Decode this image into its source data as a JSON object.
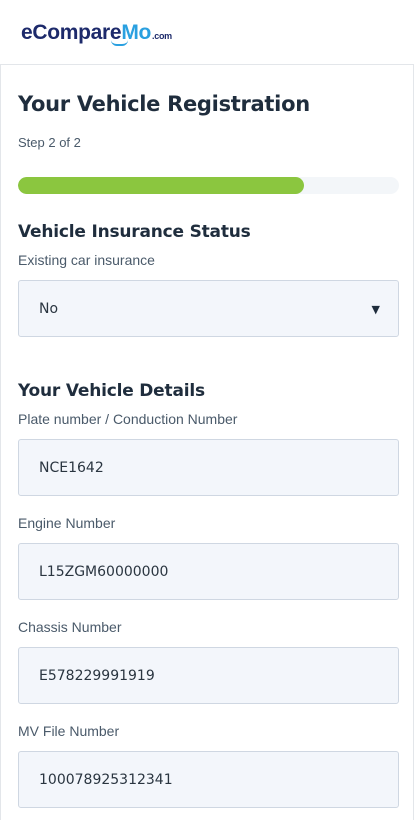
{
  "brand": {
    "logo_main": "eCompare",
    "logo_accent": "Mo",
    "logo_suffix": ".com"
  },
  "page": {
    "title": "Your Vehicle Registration",
    "step": "Step 2 of 2",
    "progress_fraction": 0.75
  },
  "insurance": {
    "section_title": "Vehicle Insurance Status",
    "existing_label": "Existing car insurance",
    "existing_value": "No",
    "caret_icon": "triangle-down-icon"
  },
  "details": {
    "section_title": "Your Vehicle Details",
    "plate_label": "Plate number / Conduction Number",
    "plate_value": "NCE1642",
    "engine_label": "Engine Number",
    "engine_value": "L15ZGM60000000",
    "chassis_label": "Chassis Number",
    "chassis_value": "E578229991919",
    "mv_label": "MV File Number",
    "mv_value": "100078925312341"
  },
  "colors": {
    "progress": "#8bc63f",
    "brand_dark": "#1d2a6b",
    "brand_accent": "#2aa0e0"
  }
}
